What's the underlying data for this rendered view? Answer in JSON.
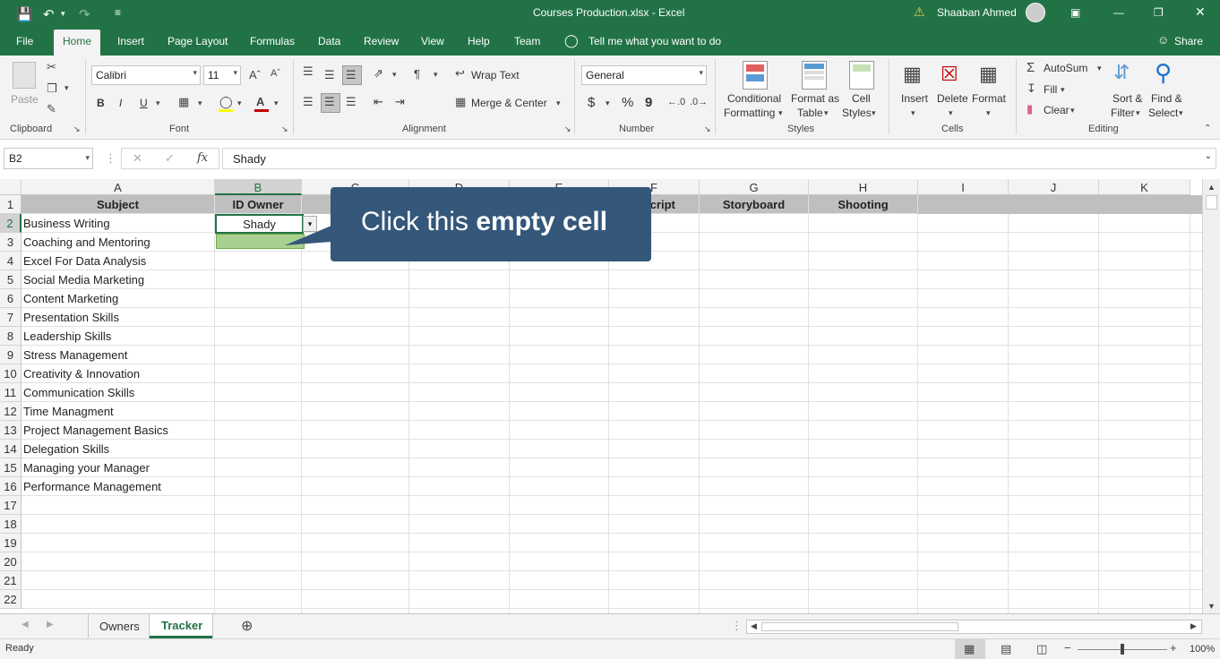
{
  "titlebar": {
    "title": "Courses Production.xlsx  -  Excel",
    "user": "Shaaban Ahmed"
  },
  "tabs": [
    "File",
    "Home",
    "Insert",
    "Page Layout",
    "Formulas",
    "Data",
    "Review",
    "View",
    "Help",
    "Team"
  ],
  "tell_me": "Tell me what you want to do",
  "share": "Share",
  "ribbon": {
    "clipboard": {
      "paste": "Paste",
      "label": "Clipboard"
    },
    "font": {
      "name": "Calibri",
      "size": "11",
      "bold": "B",
      "italic": "I",
      "underline": "U",
      "label": "Font"
    },
    "alignment": {
      "wrap": "Wrap Text",
      "merge": "Merge & Center",
      "label": "Alignment"
    },
    "number": {
      "format": "General",
      "currency": "$",
      "percent": "%",
      "comma": "9",
      "label": "Number"
    },
    "styles": {
      "conditional": "Conditional",
      "conditional2": "Formatting",
      "format_as": "Format as",
      "format_as2": "Table",
      "cell": "Cell",
      "cell2": "Styles",
      "label": "Styles"
    },
    "cells": {
      "insert": "Insert",
      "delete": "Delete",
      "format": "Format",
      "label": "Cells"
    },
    "editing": {
      "autosum": "AutoSum",
      "fill": "Fill",
      "clear": "Clear",
      "sort": "Sort &",
      "sort2": "Filter",
      "find": "Find &",
      "find2": "Select",
      "label": "Editing"
    }
  },
  "formula_bar": {
    "name_box": "B2",
    "fx": "fx",
    "value": "Shady"
  },
  "columns": [
    "A",
    "B",
    "C",
    "D",
    "E",
    "F",
    "G",
    "H",
    "I",
    "J",
    "K"
  ],
  "header_row": [
    "Subject",
    "ID Owner",
    "",
    "",
    "",
    "e Script",
    "Storyboard",
    "Shooting"
  ],
  "rows": [
    "1",
    "2",
    "3",
    "4",
    "5",
    "6",
    "7",
    "8",
    "9",
    "10",
    "11",
    "12",
    "13",
    "14",
    "15",
    "16",
    "17",
    "18",
    "19",
    "20",
    "21",
    "22"
  ],
  "subjects": [
    "Business Writing",
    "Coaching and Mentoring",
    "Excel For Data Analysis",
    "Social Media Marketing",
    "Content Marketing",
    "Presentation Skills",
    "Leadership Skills",
    "Stress Management",
    "Creativity & Innovation",
    "Communication Skills",
    "Time Managment",
    "Project Management Basics",
    "Delegation Skills",
    "Managing your Manager",
    "Performance Management"
  ],
  "b2_value": "Shady",
  "callout": {
    "prefix": "Click this ",
    "bold": "empty cell"
  },
  "sheets": [
    "Owners",
    "Tracker"
  ],
  "status": {
    "ready": "Ready",
    "zoom": "100%"
  }
}
